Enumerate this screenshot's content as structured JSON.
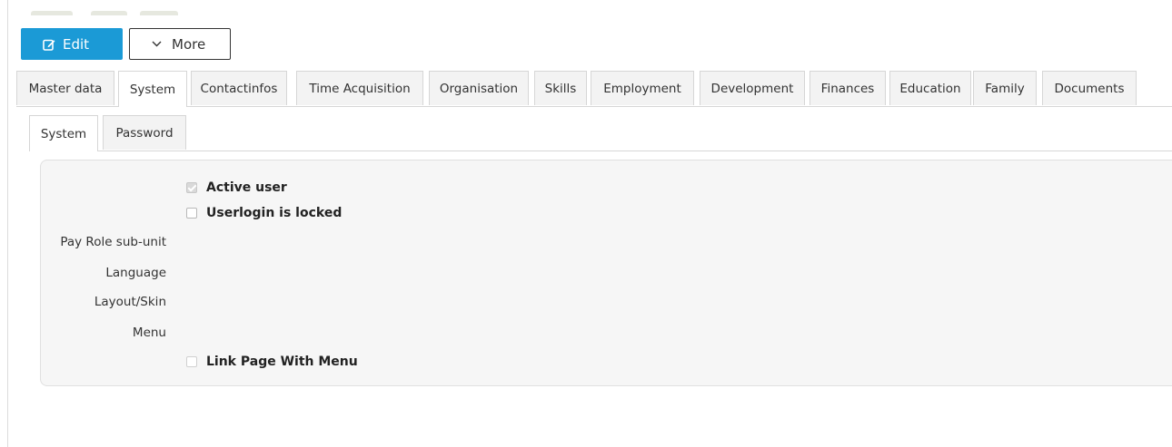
{
  "toolbar": {
    "edit_label": "Edit",
    "edit_icon": "edit-icon",
    "more_label": "More",
    "more_icon": "chevron-down-icon",
    "accent_color": "#1b9ad6"
  },
  "main_tabs": [
    {
      "label": "Master data",
      "active": false
    },
    {
      "label": "System",
      "active": true
    },
    {
      "label": "Contactinfos",
      "active": false
    },
    {
      "label": "Time Acquisition",
      "active": false
    },
    {
      "label": "Organisation",
      "active": false
    },
    {
      "label": "Skills",
      "active": false
    },
    {
      "label": "Employment",
      "active": false
    },
    {
      "label": "Development",
      "active": false
    },
    {
      "label": "Finances",
      "active": false
    },
    {
      "label": "Education",
      "active": false
    },
    {
      "label": "Family",
      "active": false
    },
    {
      "label": "Documents",
      "active": false
    }
  ],
  "sub_tabs": [
    {
      "label": "System",
      "active": true
    },
    {
      "label": "Password",
      "active": false
    }
  ],
  "form": {
    "active_user": {
      "label": "Active user",
      "checked": true,
      "disabled": true
    },
    "userlogin_locked": {
      "label": "Userlogin is locked",
      "checked": false
    },
    "pay_role_label": "Pay Role sub-unit",
    "language_label": "Language",
    "layout_skin_label": "Layout/Skin",
    "menu_label": "Menu",
    "link_page_with_menu": {
      "label": "Link Page With Menu",
      "checked": false,
      "disabled": true
    }
  }
}
